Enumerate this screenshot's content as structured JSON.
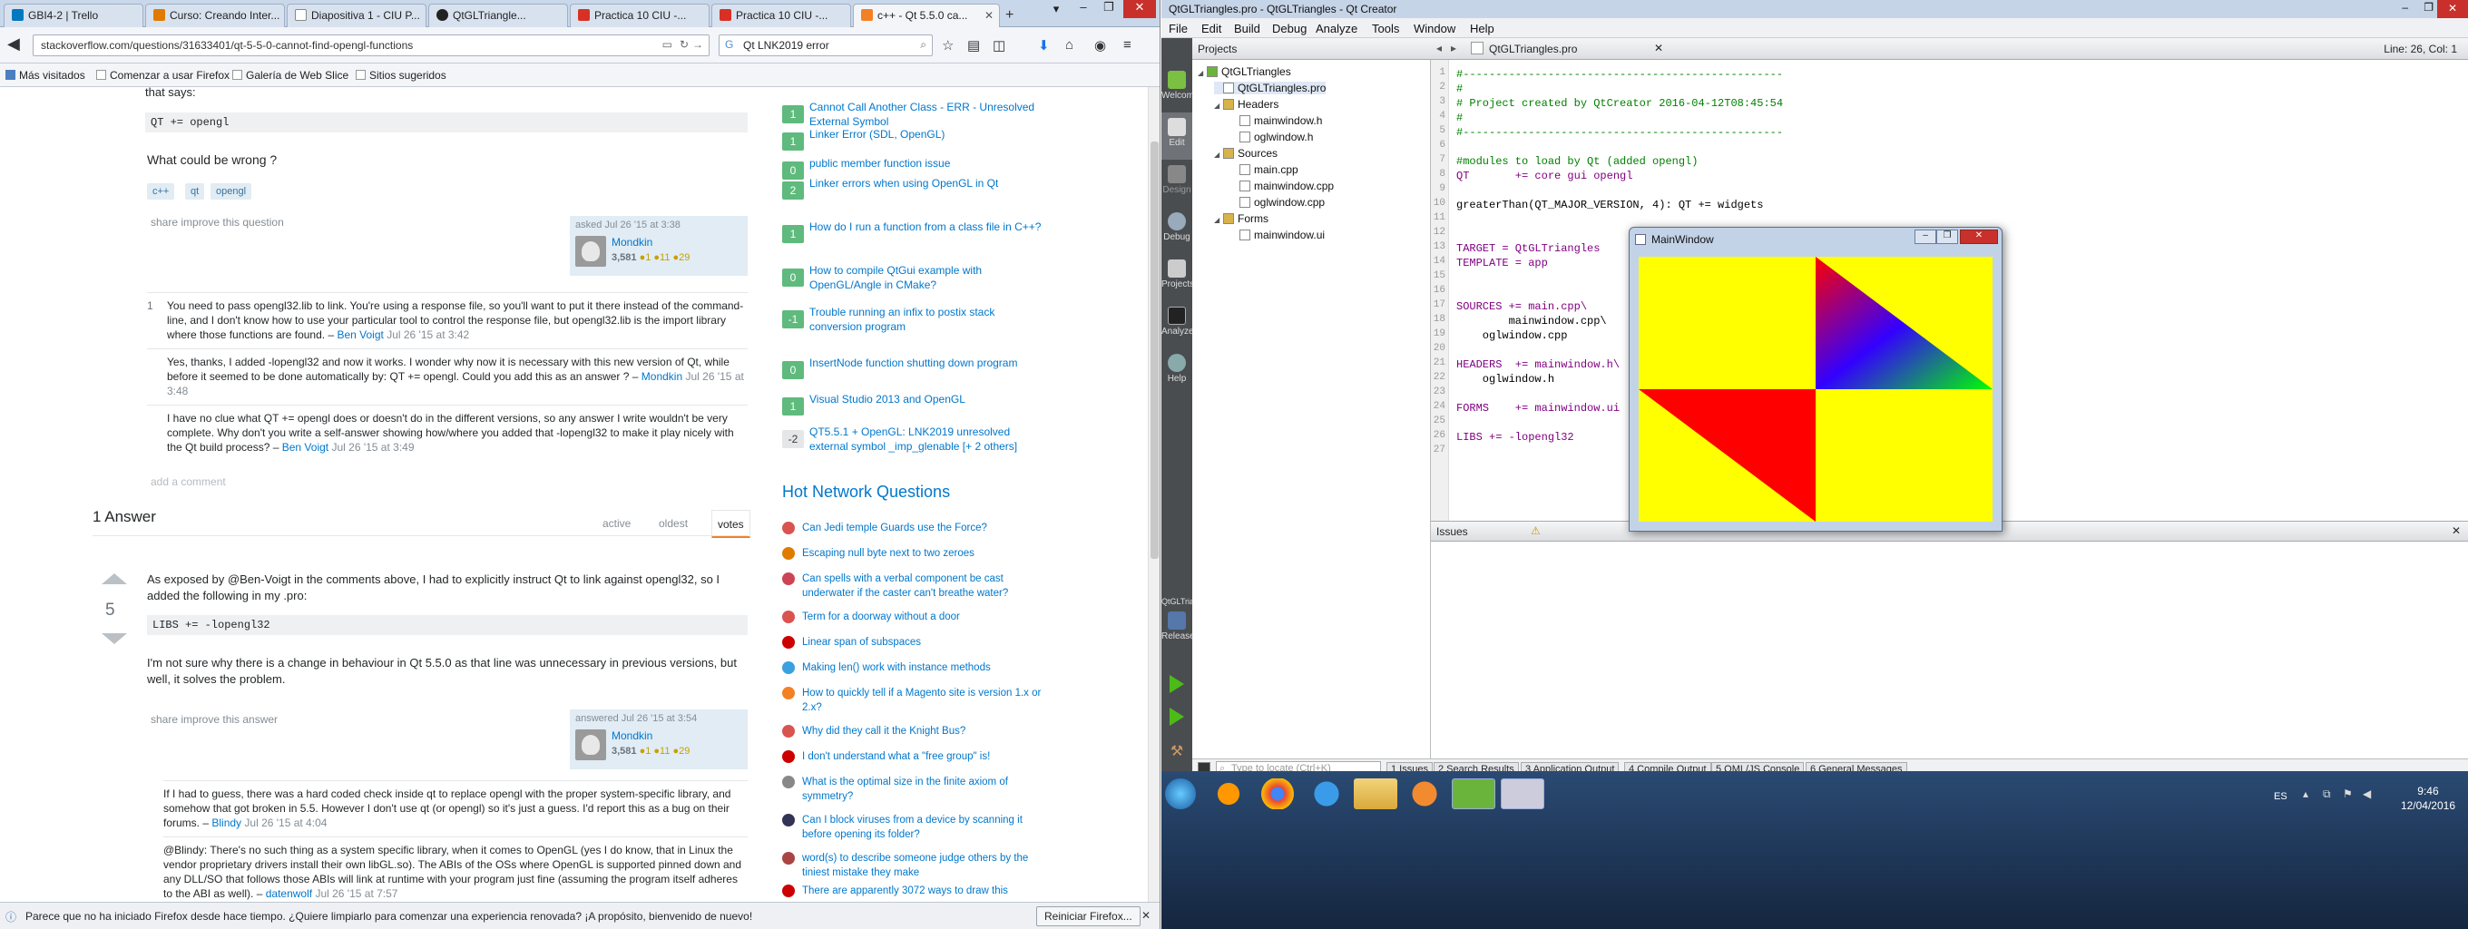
{
  "browser": {
    "tabs": [
      {
        "label": "GBI4-2 | Trello",
        "color": "#0079bf"
      },
      {
        "label": "Curso: Creando Inter...",
        "color": "#e07b00"
      },
      {
        "label": "Diapositiva 1 - CIU P...",
        "color": "#ffffff"
      },
      {
        "label": "QtGLTriangle...",
        "color": "#222222"
      },
      {
        "label": "Practica 10 CIU -...",
        "color": "#d93025"
      },
      {
        "label": "Practica 10 CIU -...",
        "color": "#d93025"
      },
      {
        "label": "c++ - Qt 5.5.0 ca...",
        "color": "#f48024"
      }
    ],
    "new_tab_label": "+",
    "url": "stackoverflow.com/questions/31633401/qt-5-5-0-cannot-find-opengl-functions",
    "search_value": "Qt LNK2019 error",
    "bookmarks": [
      "Más visitados",
      "Comenzar a usar Firefox",
      "Galería de Web Slice",
      "Sitios sugeridos"
    ],
    "notification": "Parece que no ha iniciado Firefox desde hace tiempo. ¿Quiere limpiarlo para comenzar una experiencia renovada? ¡A propósito, bienvenido de nuevo!",
    "notification_button": "Reiniciar Firefox..."
  },
  "question": {
    "intro": "that says:",
    "code": "QT += opengl",
    "prompt": "What could be wrong ?",
    "tags": [
      "c++",
      "qt",
      "opengl"
    ],
    "actions": "share  improve this question",
    "asked": "asked Jul 26 '15 at 3:38",
    "user": "Mondkin",
    "rep": "3,581",
    "badges": "●1  ●11  ●29",
    "comments": [
      {
        "n": "1",
        "text": "You need to pass opengl32.lib to link. You're using a response file, so you'll want to put it there instead of the command-line, and I don't know how to use your particular tool to control the response file, but opengl32.lib is the import library where those functions are found. –",
        "author": "Ben Voigt",
        "date": "Jul 26 '15 at 3:42"
      },
      {
        "n": "",
        "text": "Yes, thanks, I added -lopengl32 and now it works. I wonder why now it is necessary with this new version of Qt, while before it seemed to be done automatically by: QT += opengl. Could you add this as an answer ? –",
        "author": "Mondkin",
        "date": "Jul 26 '15 at 3:48"
      },
      {
        "n": "",
        "text": "I have no clue what QT += opengl does or doesn't do in the different versions, so any answer I write wouldn't be very complete. Why don't you write a self-answer showing how/where you added that -lopengl32 to make it play nicely with the Qt build process? –",
        "author": "Ben Voigt",
        "date": "Jul 26 '15 at 3:49"
      }
    ],
    "add_comment": "add a comment"
  },
  "answers": {
    "header": "1 Answer",
    "sort_tabs": [
      "active",
      "oldest",
      "votes"
    ],
    "votes": "5",
    "p1": "As exposed by @Ben-Voigt in the comments above, I had to explicitly instruct Qt to link against opengl32, so I added the following in my .pro:",
    "code": "LIBS += -lopengl32",
    "p2": "I'm not sure why there is a change in behaviour in Qt 5.5.0 as that line was unnecessary in previous versions, but well, it solves the problem.",
    "actions": "share  improve this answer",
    "answered": "answered Jul 26 '15 at 3:54",
    "user": "Mondkin",
    "rep": "3,581",
    "badges": "●1  ●11  ●29",
    "comments": [
      {
        "text": "If I had to guess, there was a hard coded check inside qt to replace opengl with the proper system-specific library, and somehow that got broken in 5.5. However I don't use qt (or opengl) so it's just a guess. I'd report this as a bug on their forums. –",
        "author": "Blindy",
        "date": "Jul 26 '15 at 4:04"
      },
      {
        "text": "@Blindy: There's no such thing as a system specific library, when it comes to OpenGL (yes I do know, that in Linux the vendor proprietary drivers install their own libGL.so). The ABIs of the OSs where OpenGL is supported pinned down and any DLL/SO that follows those ABIs will link at runtime with your program just fine (assuming the program itself adheres to the ABI as well). –",
        "author": "datenwolf",
        "date": "Jul 26 '15 at 7:57"
      }
    ]
  },
  "related": [
    {
      "votes": "1",
      "text": "Cannot Call Another Class - ERR - Unresolved External Symbol",
      "green": true
    },
    {
      "votes": "1",
      "text": "Linker Error (SDL, OpenGL)",
      "green": true
    },
    {
      "votes": "0",
      "text": "public member function issue",
      "green": true
    },
    {
      "votes": "2",
      "text": "Linker errors when using OpenGL in Qt",
      "green": true
    },
    {
      "votes": "1",
      "text": "How do I run a function from a class file in C++?",
      "green": true
    },
    {
      "votes": "0",
      "text": "How to compile QtGui example with OpenGL/Angle in CMake?",
      "green": true
    },
    {
      "votes": "-1",
      "text": "Trouble running an infix to postix stack conversion program",
      "green": true
    },
    {
      "votes": "0",
      "text": "InsertNode function shutting down program",
      "green": true
    },
    {
      "votes": "1",
      "text": "Visual Studio 2013 and OpenGL",
      "green": true
    },
    {
      "votes": "-2",
      "text": "QT5.5.1 + OpenGL: LNK2019 unresolved external symbol _imp_glenable [+ 2 others]",
      "green": false
    }
  ],
  "hnq": {
    "title": "Hot Network Questions",
    "items": [
      "Can Jedi temple Guards use the Force?",
      "Escaping null byte next to two zeroes",
      "Can spells with a verbal component be cast underwater if the caster can't breathe water?",
      "Term for a doorway without a door",
      "Linear span of subspaces",
      "Making len() work with instance methods",
      "How to quickly tell if a Magento site is version 1.x or 2.x?",
      "Why did they call it the Knight Bus?",
      "I don't understand what a \"free group\" is!",
      "What is the optimal size in the finite axiom of symmetry?",
      "Can I block viruses from a device by scanning it before opening its folder?",
      "word(s) to describe someone judge others by the tiniest mistake they make",
      "There are apparently 3072 ways to draw this"
    ]
  },
  "qt": {
    "title": "QtGLTriangles.pro - QtGLTriangles - Qt Creator",
    "menu": [
      "File",
      "Edit",
      "Build",
      "Debug",
      "Analyze",
      "Tools",
      "Window",
      "Help"
    ],
    "modes": [
      "Welcome",
      "Edit",
      "Design",
      "Debug",
      "Projects",
      "Analyze",
      "Help"
    ],
    "kit_label": "QtGLTriangles",
    "build_label": "Release",
    "projects_label": "Projects",
    "tree": [
      "QtGLTriangles",
      "QtGLTriangles.pro",
      "Headers",
      "mainwindow.h",
      "oglwindow.h",
      "Sources",
      "main.cpp",
      "mainwindow.cpp",
      "oglwindow.cpp",
      "Forms",
      "mainwindow.ui"
    ],
    "editor_file": "QtGLTriangles.pro",
    "cursor_pos": "Line: 26, Col: 1",
    "code_lines": [
      "#-------------------------------------------------",
      "#",
      "# Project created by QtCreator 2016-04-12T08:45:54",
      "#",
      "#-------------------------------------------------",
      "",
      "#modules to load by Qt (added opengl)",
      "QT       += core gui opengl",
      "",
      "greaterThan(QT_MAJOR_VERSION, 4): QT += widgets",
      "",
      "",
      "TARGET = QtGLTriangles",
      "TEMPLATE = app",
      "",
      "",
      "SOURCES += main.cpp\\",
      "        mainwindow.cpp\\",
      "    oglwindow.cpp",
      "",
      "HEADERS  += mainwindow.h\\",
      "    oglwindow.h",
      "",
      "FORMS    += mainwindow.ui",
      "",
      "LIBS += -lopengl32",
      ""
    ],
    "issues_label": "Issues",
    "locate_placeholder": "Type to locate (Ctrl+K)",
    "output_tabs": [
      "1 Issues",
      "2 Search Results",
      "3 Application Output",
      "4 Compile Output",
      "5 QML/JS Console",
      "6 General Messages"
    ],
    "mainwindow_title": "MainWindow"
  },
  "taskbar": {
    "lang": "ES",
    "time": "9:46",
    "date": "12/04/2016"
  }
}
